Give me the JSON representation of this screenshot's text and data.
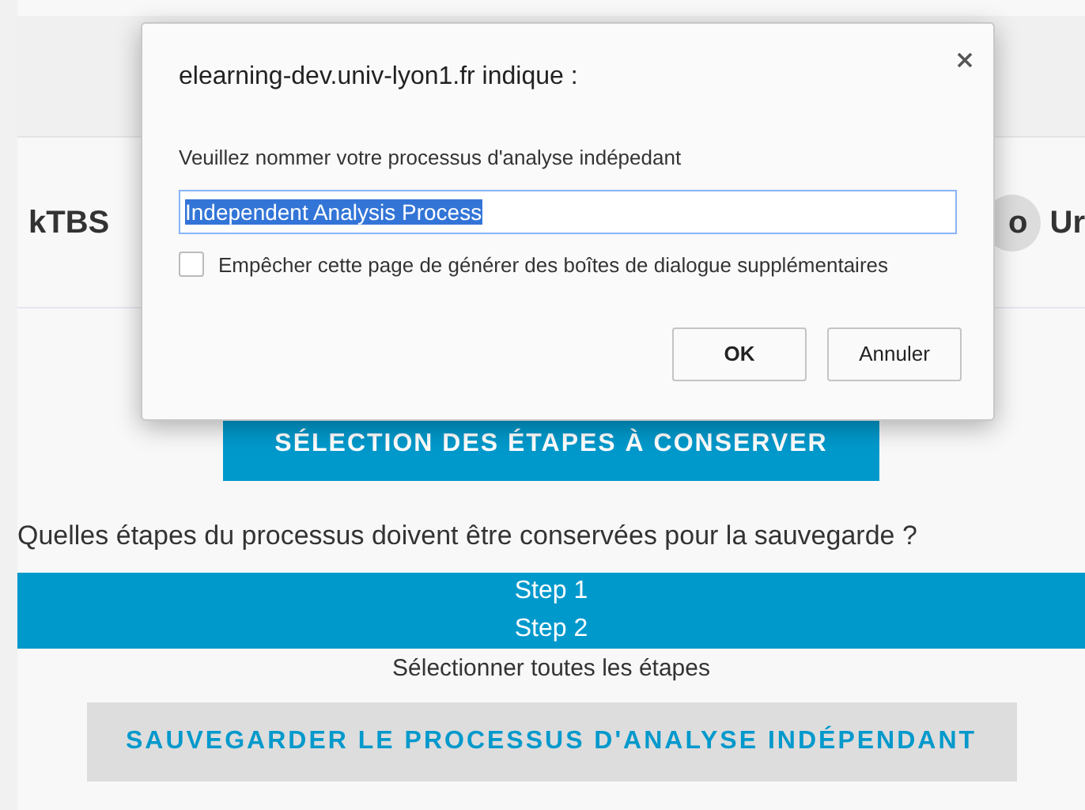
{
  "page": {
    "brand": "kTBS",
    "nav_items": [
      {
        "label": "o"
      },
      {
        "label": "Ur"
      }
    ],
    "section_button": "SÉLECTION DES ÉTAPES À CONSERVER",
    "question": "Quelles étapes du processus doivent être conservées pour la sauvegarde ?",
    "steps": [
      {
        "label": "Step 1",
        "selected": true
      },
      {
        "label": "Step 2",
        "selected": true
      }
    ],
    "select_all": "Sélectionner toutes les étapes",
    "save_button": "SAUVEGARDER LE PROCESSUS D'ANALYSE INDÉPENDANT"
  },
  "dialog": {
    "title": "elearning-dev.univ-lyon1.fr indique :",
    "message": "Veuillez nommer votre processus d'analyse indépedant",
    "value": "Independent Analysis Process",
    "text_selected": true,
    "checkbox": {
      "label": "Empêcher cette page de générer des boîtes de dialogue supplémentaires",
      "checked": false
    },
    "buttons": [
      {
        "label": "OK",
        "kind": "primary"
      },
      {
        "label": "Annuler",
        "kind": "secondary"
      }
    ]
  }
}
